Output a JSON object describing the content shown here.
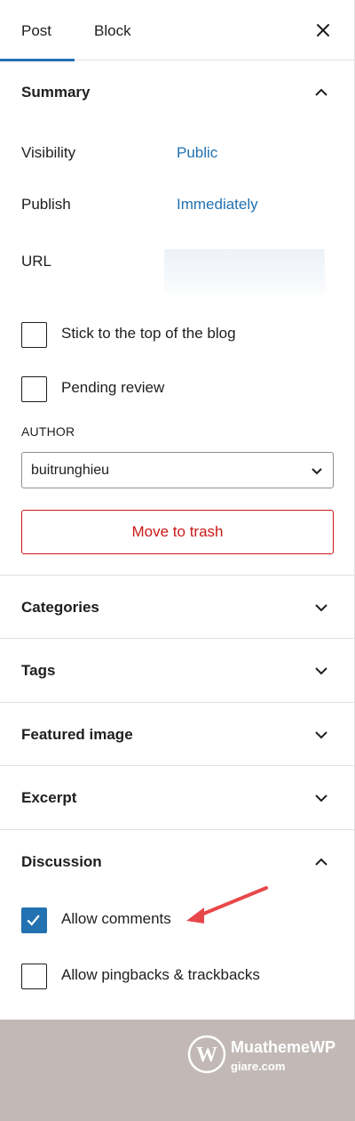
{
  "tabs": {
    "post": "Post",
    "block": "Block"
  },
  "summary": {
    "title": "Summary",
    "visibility_label": "Visibility",
    "visibility_value": "Public",
    "publish_label": "Publish",
    "publish_value": "Immediately",
    "url_label": "URL",
    "stick_label": "Stick to the top of the blog",
    "pending_label": "Pending review",
    "author_label": "AUTHOR",
    "author_value": "buitrunghieu",
    "trash_label": "Move to trash"
  },
  "sections": {
    "categories": "Categories",
    "tags": "Tags",
    "featured_image": "Featured image",
    "excerpt": "Excerpt",
    "discussion": "Discussion"
  },
  "discussion": {
    "allow_comments_label": "Allow comments",
    "allow_comments_checked": true,
    "allow_pingbacks_label": "Allow pingbacks & trackbacks",
    "allow_pingbacks_checked": false
  },
  "watermark": {
    "brand": "MuathemeWP",
    "sub": "giare.com"
  },
  "colors": {
    "accent": "#2271b1",
    "danger": "#cc1818",
    "annotation_arrow": "#e8474a",
    "footer_bg": "#c2b9b6"
  }
}
